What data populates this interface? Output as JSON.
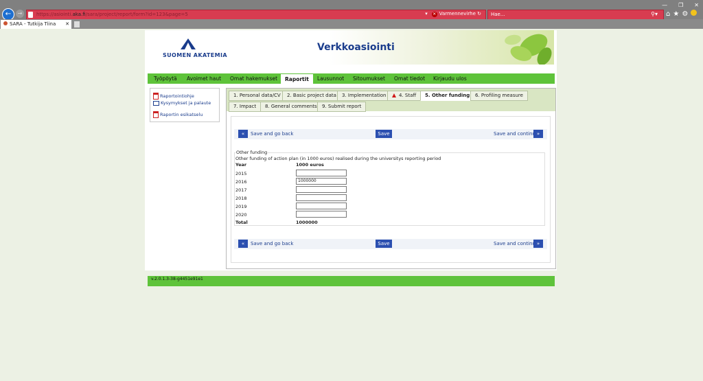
{
  "browser": {
    "url_prefix": "https://asiointi.",
    "url_domain": "aka.fi",
    "url_suffix": "/sara/project/report/form?id=123&page=5",
    "cert_label": "Varmennevirhe",
    "search_placeholder": "Hae...",
    "tab_title": "SARA - Tutkija Tiina"
  },
  "header": {
    "logo_text": "SUOMEN AKATEMIA",
    "title": "Verkkoasiointi"
  },
  "mainnav": {
    "items": [
      "Työpöytä",
      "Avoimet haut",
      "Omat hakemukset",
      "Raportit",
      "Lausunnot",
      "Sitoumukset",
      "Omat tiedot",
      "Kirjaudu ulos"
    ]
  },
  "sidebar": {
    "links": [
      "Raportointiohje",
      "Kysymykset ja palaute",
      "Raportin esikatselu"
    ]
  },
  "tabs": [
    "1. Personal data/CV",
    "2. Basic project data",
    "3. Implementation",
    "4. Staff",
    "5. Other funding",
    "6. Profiling measure",
    "7. Impact",
    "8. General comments",
    "9. Submit report"
  ],
  "buttons": {
    "prev": "«",
    "next": "»",
    "back_label": "Save and go back",
    "save": "Save",
    "continue_label": "Save and continue"
  },
  "form": {
    "legend": "Other funding",
    "description": "Other funding of action plan (in 1000 euros) realised during the universitys reporting period",
    "col_year": "Year",
    "col_value": "1000 euros",
    "rows": [
      {
        "year": "2015",
        "value": ""
      },
      {
        "year": "2016",
        "value": "1000000"
      },
      {
        "year": "2017",
        "value": ""
      },
      {
        "year": "2018",
        "value": ""
      },
      {
        "year": "2019",
        "value": ""
      },
      {
        "year": "2020",
        "value": ""
      }
    ],
    "total_label": "Total",
    "total_value": "1000000"
  },
  "footer": {
    "version": "v.2.0.1.3-38-g4451e91e1"
  },
  "colors": {
    "nav_green": "#5ec33a",
    "brand_blue": "#1a3c8c",
    "button_blue": "#2b4fb0",
    "address_bar_error": "#d83c50"
  }
}
